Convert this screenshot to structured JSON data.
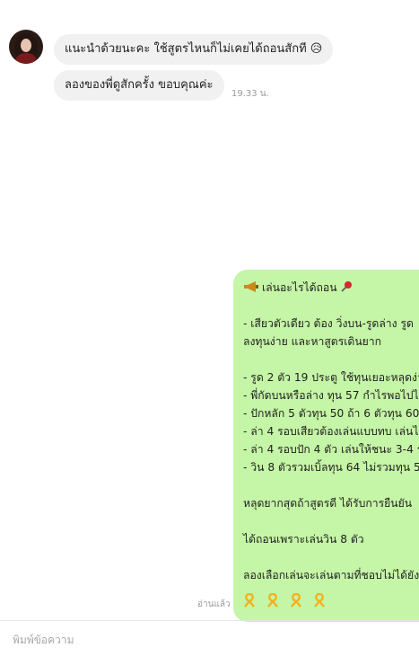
{
  "chat": {
    "incoming": [
      {
        "text": "แนะนำด้วยนะคะ ใช้สูตรไหนก็ไม่เคยได้ถอนสักที 😥"
      },
      {
        "text": "ลองของพี่ดูสักครั้ง ขอบคุณค่ะ"
      }
    ],
    "incoming_time": "19.33 น.",
    "outgoing": {
      "title": "เล่นอะไรได้ถอน",
      "lines": [
        "- เสียวตัวเดียว ต้อง วิ่งบน-รูดล่าง  รูด",
        " ลงทุนง่าย และหาสูตรเดินยาก",
        "- รูด 2 ตัว 19 ประตู ใช้ทุนเยอะหลุดง่าย",
        "- พี่กัดบนหรือล่าง ทุน 57 กำไรพอไปไ",
        "- ปักหลัก 5 ตัวทุน 50 ถ้า 6 ตัวทุน 60",
        "- ล่า 4 รอบเสียวต้องเล่นแบบทบ เล่นได้",
        "- ล่า 4 รอบปัก 4 ตัว เล่นให้ชนะ 3-4 ร",
        "- วิน 8 ตัวรวมเบิ้ลทุน 64 ไม่รวมทุน 56"
      ],
      "para1": "หลุดยากสุดถ้าสูตรดี ได้รับการยืนยัน",
      "para2": "ได้ถอนเพราะเล่นวิน 8 ตัว",
      "para3": "ลองเลือกเล่นจะเล่นตามที่ชอบไม่ได้ยัง"
    },
    "read_status": "อ่านแล้ว"
  },
  "composer": {
    "placeholder": "พิมพ์ข้อความ"
  },
  "colors": {
    "outgoing_bubble": "#c5f5a6",
    "incoming_bubble": "#f1f1f1"
  }
}
